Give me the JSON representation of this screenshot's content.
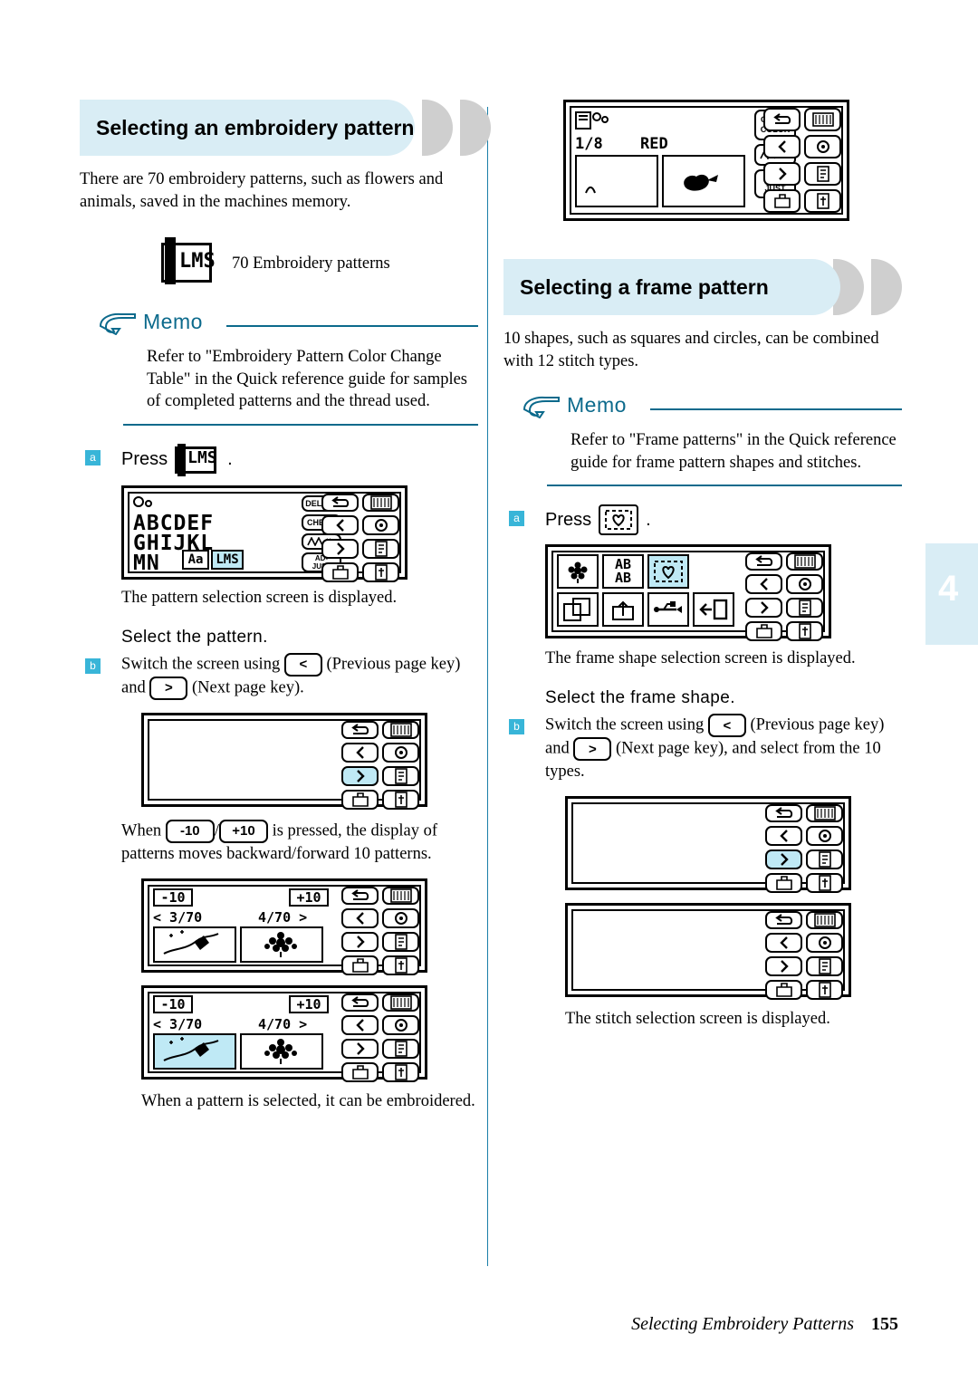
{
  "page": {
    "number": "155",
    "footer_title": "Selecting Embroidery Patterns",
    "chapter_tab": "4"
  },
  "left": {
    "heading": "Selecting an embroidery pattern",
    "intro": "There are 70 embroidery patterns, such as flowers and animals, saved in the machines memory.",
    "pattern_count_label": "70 Embroidery patterns",
    "pattern_icon_label": "LMS",
    "memo": {
      "title": "Memo",
      "text": "Refer to \"Embroidery Pattern Color Change Table\" in the Quick reference guide for samples of completed patterns and the thread used."
    },
    "step_a": {
      "num": "a",
      "press_label": "Press",
      "press_key": "LMS",
      "period": ".",
      "caption": "The pattern selection screen is displayed."
    },
    "step_b": {
      "num": "b",
      "title": "Select the pattern.",
      "text_before": "Switch the screen using",
      "text_mid": "(Previous page key) and",
      "text_after": "(Next page key).",
      "prev_key": "<",
      "next_key": ">"
    },
    "note_when": {
      "before": "When",
      "key_minus": "-10",
      "slash": "/",
      "key_plus": "+10",
      "after": "is pressed, the display of patterns moves backward/forward 10 patterns."
    },
    "final_caption": "When a pattern is selected, it can be embroidered.",
    "lcd_keys": {
      "delete": "DELETE",
      "check": "CHECK",
      "adjust_top": "AD-",
      "adjust_bottom": "JUST",
      "aa_label": "Aa",
      "lms_label": "LMS",
      "alpha_row1": "ABCDEF",
      "alpha_row2": "GHIJKL",
      "alpha_row3": "MN"
    },
    "lcd_page": {
      "minus10": "-10",
      "plus10": "+10",
      "left_counter": "< 3/70",
      "right_counter": "4/70 >"
    }
  },
  "right": {
    "top_lcd": {
      "counter": "1/8",
      "color": "RED",
      "check_color_top": "CHECK",
      "check_color_bottom": "COLOR",
      "adjust_top": "AD-",
      "adjust_bottom": "JUST"
    },
    "heading": "Selecting a frame pattern",
    "intro": "10 shapes, such as squares and circles, can be combined with 12 stitch types.",
    "memo": {
      "title": "Memo",
      "text": "Refer to \"Frame patterns\" in the Quick reference guide for frame pattern shapes and stitches."
    },
    "step_a": {
      "num": "a",
      "press_label": "Press",
      "period": ".",
      "caption": "The frame shape selection screen is displayed."
    },
    "step_b": {
      "num": "b",
      "title": "Select the frame shape.",
      "text_before": "Switch the screen using",
      "text_mid": "(Previous page key) and",
      "text_after": "(Next page key), and select from the 10 types.",
      "prev_key": "<",
      "next_key": ">"
    },
    "final_caption": "The stitch selection screen is displayed.",
    "lcd_keys": {
      "ab_top": "AB",
      "ab_bottom": "AB"
    }
  },
  "colors": {
    "accent": "#38b5d8",
    "banner_bg": "#d9edf5",
    "banner_tail": "#cfcfcf",
    "memo_blue": "#0c6a8c",
    "highlight": "#bfe9f5"
  }
}
